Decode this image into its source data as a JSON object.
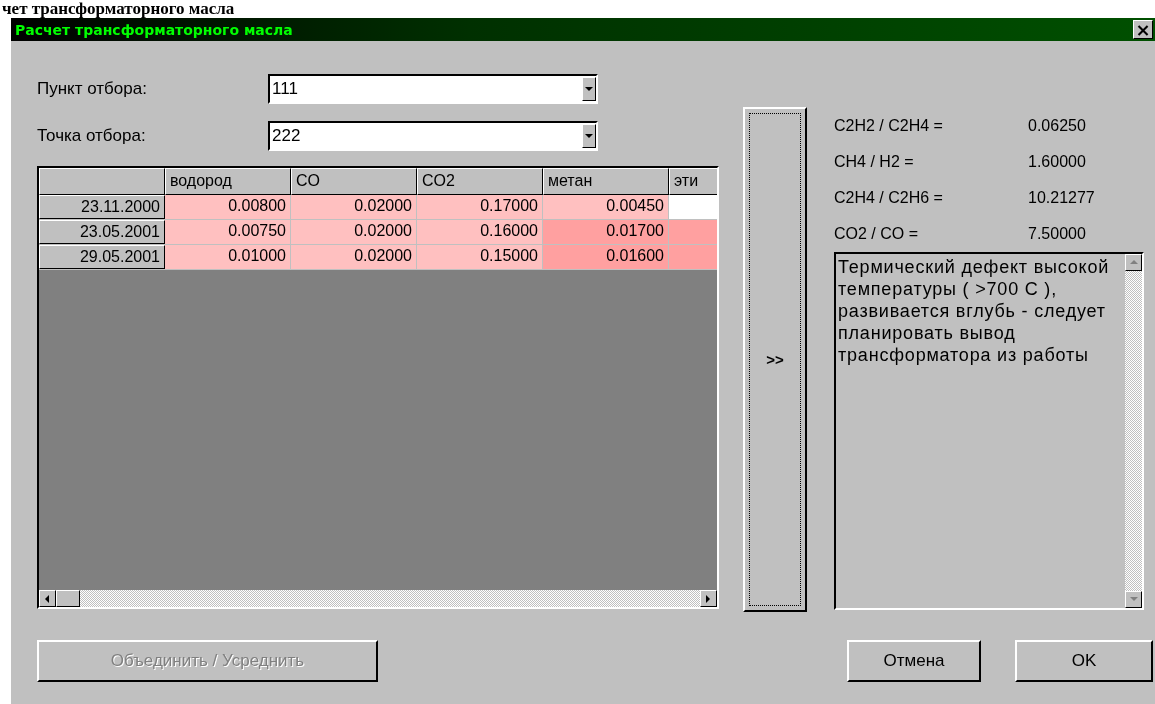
{
  "page_heading": "чет трансформаторного масла",
  "window": {
    "title": "Расчет трансформаторного масла",
    "close": "×"
  },
  "fields": [
    {
      "label": "Пункт отбора:",
      "value": "111"
    },
    {
      "label": "Точка отбора:",
      "value": "222"
    }
  ],
  "grid": {
    "columns": [
      "водород",
      "CO",
      "CO2",
      "метан",
      "эти"
    ],
    "rows": [
      {
        "date": "23.11.2000",
        "cells": [
          {
            "value": "0.00800",
            "color": "#ffc0c0"
          },
          {
            "value": "0.02000",
            "color": "#ffc0c0"
          },
          {
            "value": "0.17000",
            "color": "#ffc0c0"
          },
          {
            "value": "0.00450",
            "color": "#ffc0c0"
          },
          {
            "color": "#ffffff"
          }
        ]
      },
      {
        "date": "23.05.2001",
        "cells": [
          {
            "value": "0.00750",
            "color": "#ffc0c0"
          },
          {
            "value": "0.02000",
            "color": "#ffc0c0"
          },
          {
            "value": "0.16000",
            "color": "#ffc0c0"
          },
          {
            "value": "0.01700",
            "color": "#ffa0a0"
          },
          {
            "color": "#ffa0a0"
          }
        ]
      },
      {
        "date": "29.05.2001",
        "cells": [
          {
            "value": "0.01000",
            "color": "#ffc0c0"
          },
          {
            "value": "0.02000",
            "color": "#ffc0c0"
          },
          {
            "value": "0.15000",
            "color": "#ffc0c0"
          },
          {
            "value": "0.01600",
            "color": "#ffa0a0"
          },
          {
            "color": "#ffa0a0"
          }
        ]
      }
    ]
  },
  "transfer_button": ">>",
  "ratios": [
    {
      "label": "C2H2 / C2H4 =",
      "value": "0.06250"
    },
    {
      "label": "CH4 / H2 =",
      "value": "1.60000"
    },
    {
      "label": "C2H4 / C2H6 =",
      "value": "10.21277"
    },
    {
      "label": "CO2 / CO =",
      "value": "7.50000"
    }
  ],
  "diagnosis": "Термический дефект высокой температуры ( >700 C ), развивается вглубь - следует планировать вывод трансформатора из работы",
  "buttons": [
    {
      "label": "Объединить / Усреднить",
      "disabled": true
    },
    {
      "label": "Отмена",
      "disabled": false
    },
    {
      "label": "OK",
      "disabled": false
    }
  ]
}
